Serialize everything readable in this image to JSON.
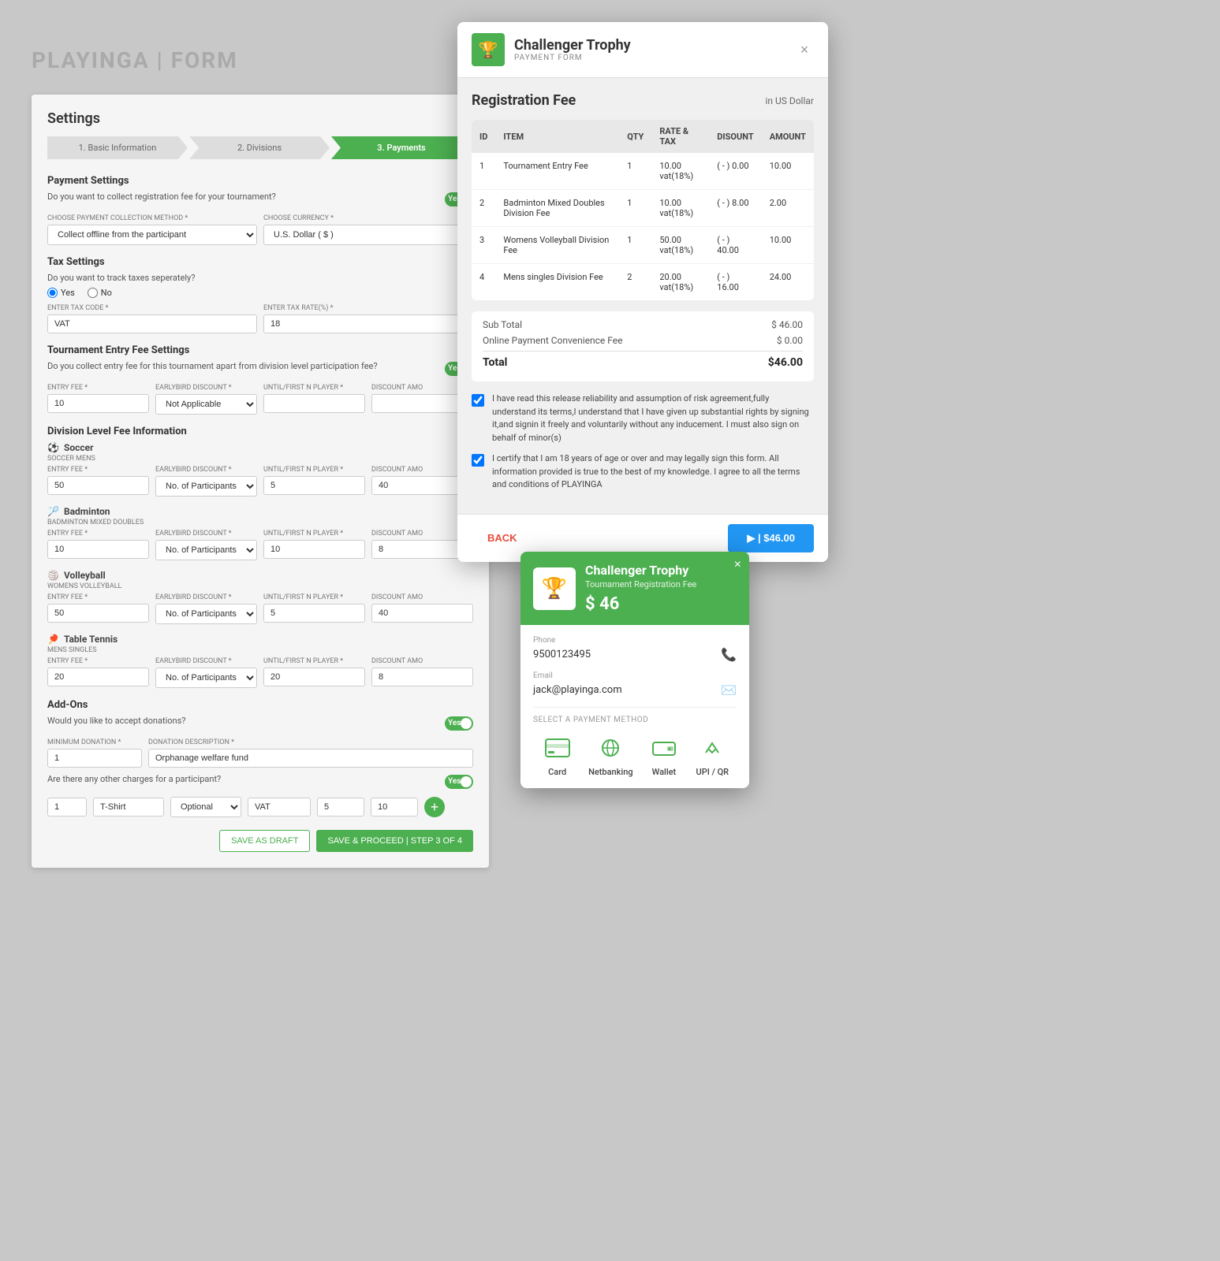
{
  "bg_title": "PLAYINGA | FORM",
  "settings": {
    "title": "Settings",
    "steps": [
      {
        "label": "1. Basic Information",
        "active": false
      },
      {
        "label": "2. Divisions",
        "active": false
      },
      {
        "label": "3. Payments",
        "active": true
      }
    ],
    "payment_settings": {
      "heading": "Payment Settings",
      "question": "Do you want to collect registration fee for your tournament?",
      "toggle": "Yes",
      "collection_method_label": "CHOOSE PAYMENT COLLECTION METHOD *",
      "collection_method_value": "Collect offline from the participant",
      "currency_label": "CHOOSE CURRENCY *",
      "currency_value": "U.S. Dollar ( $ )"
    },
    "tax_settings": {
      "heading": "Tax Settings",
      "question": "Do you want to track taxes seperately?",
      "radio_yes": "Yes",
      "radio_no": "No",
      "tax_code_label": "ENTER TAX CODE *",
      "tax_code_value": "VAT",
      "tax_rate_label": "ENTER TAX RATE(%) *",
      "tax_rate_value": "18"
    },
    "entry_fee_settings": {
      "heading": "Tournament Entry Fee Settings",
      "question": "Do you collect entry fee for this tournament apart from division level participation fee?",
      "toggle": "Yes",
      "entry_fee_label": "ENTRY FEE *",
      "entry_fee_value": "10",
      "earlybird_label": "EARLYBIRD DISCOUNT *",
      "earlybird_value": "Not Applicable",
      "until_label": "UNTIL/FIRST N PLAYER *",
      "discount_label": "DISCOUNT AMO"
    },
    "division_fee": {
      "heading": "Division Level Fee Information",
      "sports": [
        {
          "icon": "⚽",
          "name": "Soccer",
          "division": "SOCCER MENS",
          "entry_fee": "50",
          "earlybird": "No. of Participants",
          "until": "5",
          "discount": "40"
        },
        {
          "icon": "🏸",
          "name": "Badminton",
          "division": "BADMINTON MIXED DOUBLES",
          "entry_fee": "10",
          "earlybird": "No. of Participants",
          "until": "10",
          "discount": "8"
        },
        {
          "icon": "🏐",
          "name": "Volleyball",
          "division": "WOMENS VOLLEYBALL",
          "entry_fee": "50",
          "earlybird": "No. of Participants",
          "until": "5",
          "discount": "40"
        },
        {
          "icon": "🏓",
          "name": "Table Tennis",
          "division": "MENS SINGLES",
          "entry_fee": "20",
          "earlybird": "No. of Participants",
          "until": "20",
          "discount": "8"
        }
      ]
    },
    "addons": {
      "heading": "Add-Ons",
      "donations_question": "Would you like to accept donations?",
      "donations_toggle": "Yes",
      "min_donation_label": "MINIMUM DONATION *",
      "min_donation_value": "1",
      "donation_desc_label": "DONATION DESCRIPTION *",
      "donation_desc_value": "Orphanage welfare fund",
      "other_charges_question": "Are there any other charges for a participant?",
      "other_charges_toggle": "Yes",
      "charge_qty": "1",
      "charge_name": "T-Shirt",
      "charge_optional": "Optional",
      "charge_tax": "VAT",
      "charge_amount": "5",
      "charge_total": "10"
    },
    "buttons": {
      "save_draft": "SAVE AS DRAFT",
      "proceed": "SAVE & PROCEED | STEP 3 OF 4"
    }
  },
  "payment_form": {
    "title": "Challenger Trophy",
    "subtitle": "PAYMENT FORM",
    "close_button": "×",
    "reg_fee_title": "Registration Fee",
    "currency_label": "in US Dollar",
    "table": {
      "headers": [
        "ID",
        "ITEM",
        "QTY",
        "RATE & TAX",
        "DISOUNT",
        "AMOUNT"
      ],
      "rows": [
        {
          "id": "1",
          "item": "Tournament Entry Fee",
          "qty": "1",
          "rate": "10.00\nvat(18%)",
          "discount": "( - ) 0.00",
          "amount": "10.00"
        },
        {
          "id": "2",
          "item": "Badminton Mixed Doubles Division Fee",
          "qty": "1",
          "rate": "10.00\nvat(18%)",
          "discount": "( - ) 8.00",
          "amount": "2.00"
        },
        {
          "id": "3",
          "item": "Womens Volleyball Division Fee",
          "qty": "1",
          "rate": "50.00\nvat(18%)",
          "discount": "( - ) 40.00",
          "amount": "10.00"
        },
        {
          "id": "4",
          "item": "Mens singles Division Fee",
          "qty": "2",
          "rate": "20.00\nvat(18%)",
          "discount": "( - ) 16.00",
          "amount": "24.00"
        }
      ]
    },
    "subtotal_label": "Sub Total",
    "subtotal_value": "$ 46.00",
    "convenience_fee_label": "Online Payment Convenience Fee",
    "convenience_fee_value": "$ 0.00",
    "total_label": "Total",
    "total_value": "$46.00",
    "agreement_text_1": "I have read this release reliability and assumption of risk agreement,fully understand its terms,I understand that I have given up substantial rights by signing it,and signin it freely and voluntarily without any inducement. I must also sign on behalf of minor(s)",
    "agreement_text_2": "I certify that I am 18 years of age or over and may legally sign this form. All information provided is true to the best of my knowledge. I agree to all the terms and conditions of PLAYINGA",
    "back_button": "BACK",
    "pay_button": "▶ | $46.00"
  },
  "razorpay": {
    "close": "×",
    "org_name": "Challenger Trophy",
    "org_desc": "Tournament Registration Fee",
    "amount": "$ 46",
    "phone_label": "Phone",
    "phone_value": "9500123495",
    "email_label": "Email",
    "email_value": "jack@playinga.com",
    "select_method_label": "SELECT A PAYMENT METHOD",
    "methods": [
      {
        "icon": "💳",
        "label": "Card",
        "name": "card-method"
      },
      {
        "icon": "🌐",
        "label": "Netbanking",
        "name": "netbanking-method"
      },
      {
        "icon": "👛",
        "label": "Wallet",
        "name": "wallet-method"
      },
      {
        "icon": "📱",
        "label": "UPI / QR",
        "name": "upi-method"
      }
    ]
  }
}
